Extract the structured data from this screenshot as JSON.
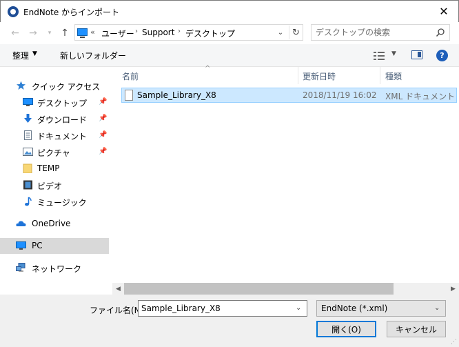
{
  "window": {
    "title": "EndNote からインポート",
    "close_label": "✕"
  },
  "address": {
    "chevrons": "«",
    "crumbs": [
      "ユーザー",
      "Support",
      "デスクトップ"
    ],
    "separator": "›"
  },
  "search": {
    "placeholder": "デスクトップの検索"
  },
  "toolbar": {
    "organize_label": "整理",
    "new_folder_label": "新しいフォルダー"
  },
  "nav": {
    "quick_access": "クイック アクセス",
    "items": [
      {
        "label": "デスクトップ",
        "icon": "desktop-icon",
        "pinned": true
      },
      {
        "label": "ダウンロード",
        "icon": "download-icon",
        "pinned": true
      },
      {
        "label": "ドキュメント",
        "icon": "document-icon",
        "pinned": true
      },
      {
        "label": "ピクチャ",
        "icon": "pictures-icon",
        "pinned": true
      },
      {
        "label": "TEMP",
        "icon": "folder-icon",
        "pinned": false
      },
      {
        "label": "ビデオ",
        "icon": "video-icon",
        "pinned": false
      },
      {
        "label": "ミュージック",
        "icon": "music-icon",
        "pinned": false
      }
    ],
    "onedrive": "OneDrive",
    "pc": "PC",
    "network": "ネットワーク"
  },
  "file_list": {
    "columns": [
      "名前",
      "更新日時",
      "種類"
    ],
    "rows": [
      {
        "name": "Sample_Library_X8",
        "date": "2018/11/19 16:02",
        "type": "XML ドキュメント",
        "selected": true
      }
    ]
  },
  "bottom": {
    "filename_label": "ファイル名(N):",
    "filename_value": "Sample_Library_X8",
    "filetype_value": "EndNote (*.xml)",
    "open_label": "開く(O)",
    "cancel_label": "キャンセル"
  },
  "colors": {
    "selection_bg": "#cce8ff",
    "selection_border": "#99d1ff",
    "accent": "#0078d7",
    "nav_selected": "#d9d9d9"
  }
}
